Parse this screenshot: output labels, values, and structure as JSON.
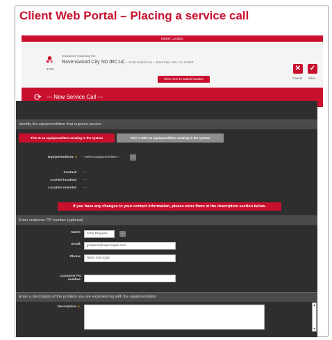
{
  "slide": {
    "title": "Client Web Portal – Placing a service call"
  },
  "master_location": "Master Location",
  "location": {
    "gateway_label": "Customer Gateway for:",
    "name": "Ravenswood City SD (RC14)",
    "address": " – 2120 Euclid Ave – East Palo Alto, CA 94303-",
    "id": "1793",
    "switch_label": "Click Here to Switch location",
    "cancel_label": "Cancel",
    "save_label": "Save"
  },
  "new_call": {
    "title": "— New Service Call —"
  },
  "identify": {
    "heading": "Identify the equipment/item that requires service",
    "toggle_on": "This IS an equipment/item existing in the system",
    "toggle_off": "This is NOT an equipment/item existing in the system",
    "equipment_label": "Equipment/Item:",
    "equipment_value": "-- Select equipment/item --",
    "contact_label": "Contact:",
    "contact_value": "---",
    "current_location_label": "Current location:",
    "current_location_value": "---",
    "location_remarks_label": "Location remarks:",
    "location_remarks_value": "---"
  },
  "warning": "If you have any changes to your contact information, please enter them in the description section below.",
  "po": {
    "heading": "Enter customer PO number (optional)",
    "name_label": "Name:",
    "name_value": "John Propersi",
    "email_label": "Email:",
    "email_value": "jpropersi@raymorgan.com",
    "phone_label": "Phone:",
    "phone_value": "(925) 400-4162",
    "po_label_1": "Customer PO",
    "po_label_2": "number:"
  },
  "description": {
    "heading": "Enter a description of the problem you are experiencing with the equipment/item",
    "label": "Description:"
  },
  "colors": {
    "accent": "#c8102e",
    "dark": "#2e2e2e",
    "required": "#f39c12"
  }
}
